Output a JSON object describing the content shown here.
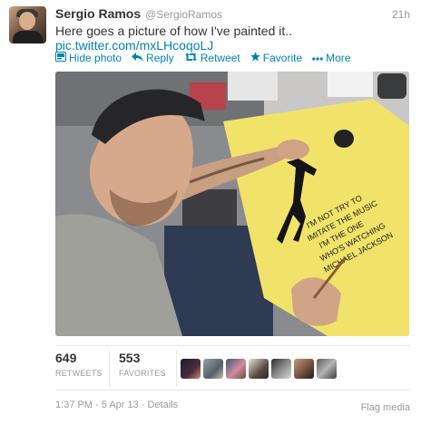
{
  "tweet": {
    "author": {
      "full_name": "Sergio Ramos",
      "screen_name": "@SergioRamos"
    },
    "timestamp": "21h",
    "text": "Here goes a picture of how I've painted it..",
    "link": "pic.twitter.com/mxLHcoqoLJ"
  },
  "actions": {
    "hide_photo": "Hide photo",
    "reply": "Reply",
    "retweet": "Retweet",
    "favorite": "Favorite",
    "more": "More"
  },
  "icons": {
    "hide_photo": "photo-icon",
    "reply": "reply-icon",
    "retweet": "retweet-icon",
    "favorite": "star-icon",
    "more": "ellipsis-icon"
  },
  "stats": {
    "retweets": {
      "count": "649",
      "label": "RETWEETS"
    },
    "favorites": {
      "count": "553",
      "label": "FAVORITES"
    }
  },
  "footer": {
    "details": "1:37 PM - 5 Apr 13 · Details",
    "flag": "Flag media"
  },
  "photo_shirt_text": [
    "I'M NOT TRY TO",
    "IMITATE THE MUSIC",
    "I'M THE ONE",
    "WHO'S WATCHING",
    "MICHAEL JACKSON"
  ],
  "colors": {
    "link": "#0084b4",
    "shirt": "#f1e36a",
    "muted": "#999999"
  }
}
